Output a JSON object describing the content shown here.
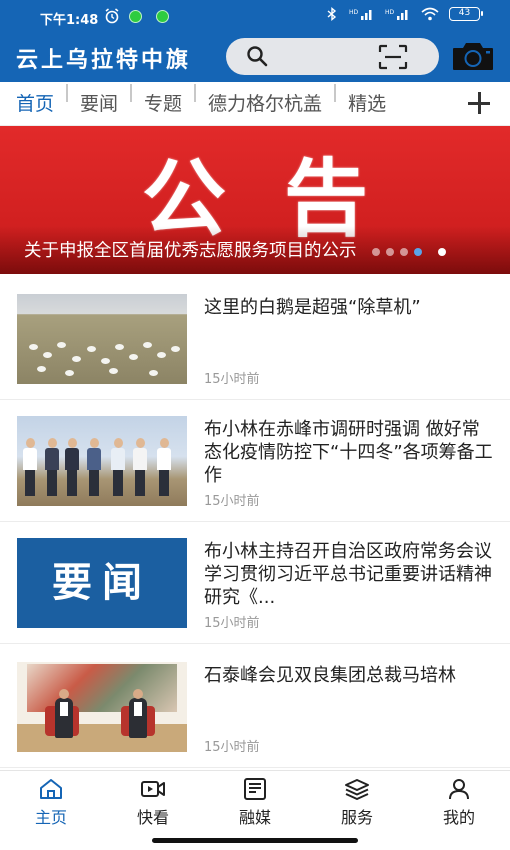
{
  "status_bar": {
    "time": "下午1:48",
    "battery": "43"
  },
  "app_bar": {
    "title": "云上乌拉特中旗"
  },
  "channel_tabs": [
    {
      "label": "首页",
      "active": true
    },
    {
      "label": "要闻",
      "active": false
    },
    {
      "label": "专题",
      "active": false
    },
    {
      "label": "德力格尔杭盖",
      "active": false
    },
    {
      "label": "精选",
      "active": false
    }
  ],
  "banner": {
    "headline": "公告",
    "caption": "关于申报全区首届优秀志愿服务项目的公示",
    "slide_count": 5,
    "active_slide": 5
  },
  "news": [
    {
      "title": "这里的白鹅是超强“除草机”",
      "time": "15小时前",
      "thumb": "geese-field-photo"
    },
    {
      "title": "布小林在赤峰市调研时强调 做好常态化疫情防控下“十四冬”各项筹备工作",
      "time": "15小时前",
      "thumb": "officials-outdoor-photo"
    },
    {
      "title": "布小林主持召开自治区政府常务会议 学习贯彻习近平总书记重要讲话精神 研究《...",
      "time": "15小时前",
      "thumb": "yaowen-graphic",
      "thumb_text": "要闻"
    },
    {
      "title": "石泰峰会见双良集团总裁马培林",
      "time": "15小时前",
      "thumb": "meeting-room-photo"
    }
  ],
  "bottom_nav": [
    {
      "label": "主页",
      "icon": "home-icon",
      "active": true
    },
    {
      "label": "快看",
      "icon": "video-icon",
      "active": false
    },
    {
      "label": "融媒",
      "icon": "newspaper-icon",
      "active": false
    },
    {
      "label": "服务",
      "icon": "layers-icon",
      "active": false
    },
    {
      "label": "我的",
      "icon": "person-icon",
      "active": false
    }
  ],
  "colors": {
    "brand_blue": "#1565b5",
    "banner_red": "#d42020",
    "muted_text": "#999999"
  }
}
